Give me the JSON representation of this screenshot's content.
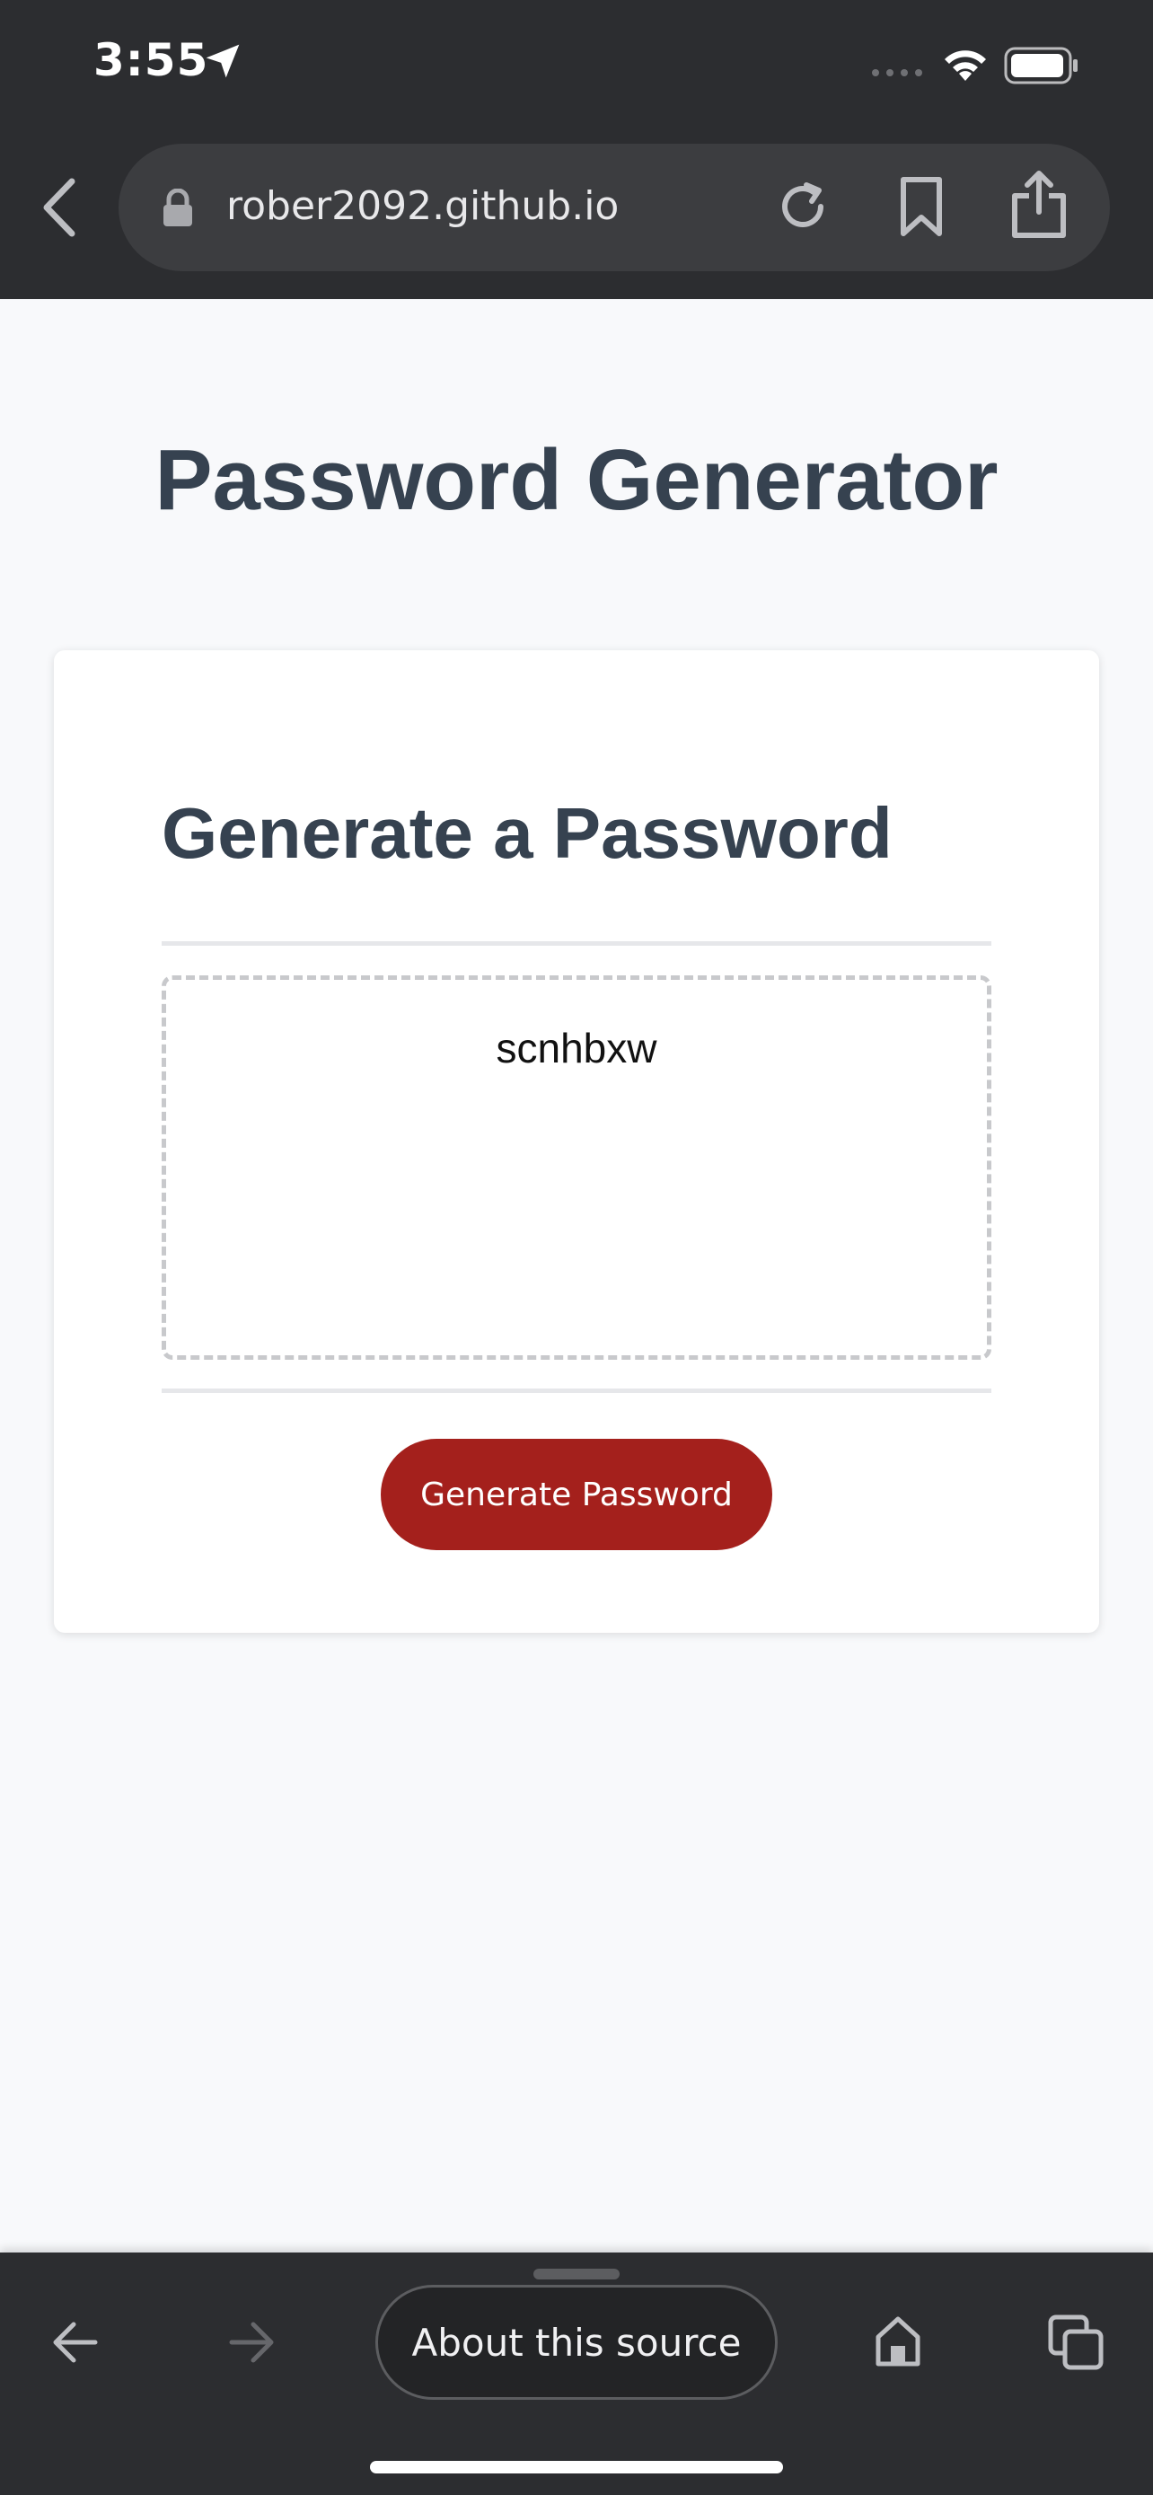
{
  "status_bar": {
    "time": "3:55"
  },
  "browser": {
    "url": "rober2092.github.io"
  },
  "page": {
    "title": "Password Generator",
    "card_heading": "Generate a Password",
    "password_value": "scnhbxw",
    "generate_button_label": "Generate Password",
    "accent_color": "#a4201c",
    "heading_color": "#364250"
  },
  "bottom_bar": {
    "about_label": "About this source"
  }
}
